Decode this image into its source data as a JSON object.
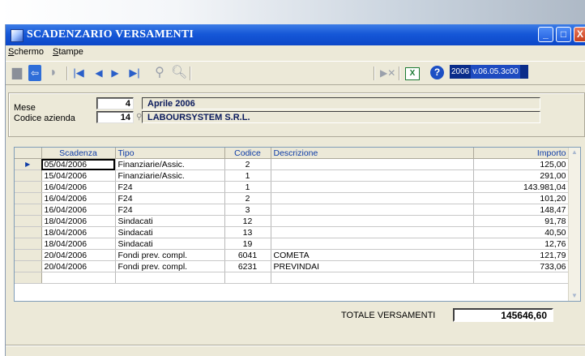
{
  "window": {
    "title": "SCADENZARIO VERSAMENTI"
  },
  "menu": {
    "items": [
      {
        "label": "Schermo",
        "underline": "S"
      },
      {
        "label": "Stampe",
        "underline": "S"
      }
    ]
  },
  "toolbar": {
    "version_year": "2006",
    "version": "v.06.05.3c00"
  },
  "form": {
    "mese_label": "Mese",
    "mese_num": "4",
    "mese_text": "Aprile   2006",
    "azienda_label": "Codice azienda",
    "azienda_num": "14",
    "azienda_text": "LABOURSYSTEM S.R.L."
  },
  "table": {
    "headers": [
      "Scadenza",
      "Tipo",
      "Codice",
      "Descrizione",
      "Importo"
    ],
    "rows": [
      {
        "scadenza": "05/04/2006",
        "tipo": "Finanziarie/Assic.",
        "codice": "2",
        "descrizione": "",
        "importo": "125,00"
      },
      {
        "scadenza": "15/04/2006",
        "tipo": "Finanziarie/Assic.",
        "codice": "1",
        "descrizione": "",
        "importo": "291,00"
      },
      {
        "scadenza": "16/04/2006",
        "tipo": "F24",
        "codice": "1",
        "descrizione": "",
        "importo": "143.981,04"
      },
      {
        "scadenza": "16/04/2006",
        "tipo": "F24",
        "codice": "2",
        "descrizione": "",
        "importo": "101,20"
      },
      {
        "scadenza": "16/04/2006",
        "tipo": "F24",
        "codice": "3",
        "descrizione": "",
        "importo": "148,47"
      },
      {
        "scadenza": "18/04/2006",
        "tipo": "Sindacati",
        "codice": "12",
        "descrizione": "",
        "importo": "91,78"
      },
      {
        "scadenza": "18/04/2006",
        "tipo": "Sindacati",
        "codice": "13",
        "descrizione": "",
        "importo": "40,50"
      },
      {
        "scadenza": "18/04/2006",
        "tipo": "Sindacati",
        "codice": "19",
        "descrizione": "",
        "importo": "12,76"
      },
      {
        "scadenza": "20/04/2006",
        "tipo": "Fondi prev. compl.",
        "codice": "6041",
        "descrizione": "COMETA",
        "importo": "121,79"
      },
      {
        "scadenza": "20/04/2006",
        "tipo": "Fondi prev. compl.",
        "codice": "6231",
        "descrizione": "PREVINDAI",
        "importo": "733,06"
      }
    ]
  },
  "totale": {
    "label": "TOTALE VERSAMENTI",
    "value": "145646,60"
  },
  "colors": {
    "titlebar": "#0c47c8",
    "header_text": "#0d3ba6",
    "window_bg": "#ece9d8"
  }
}
